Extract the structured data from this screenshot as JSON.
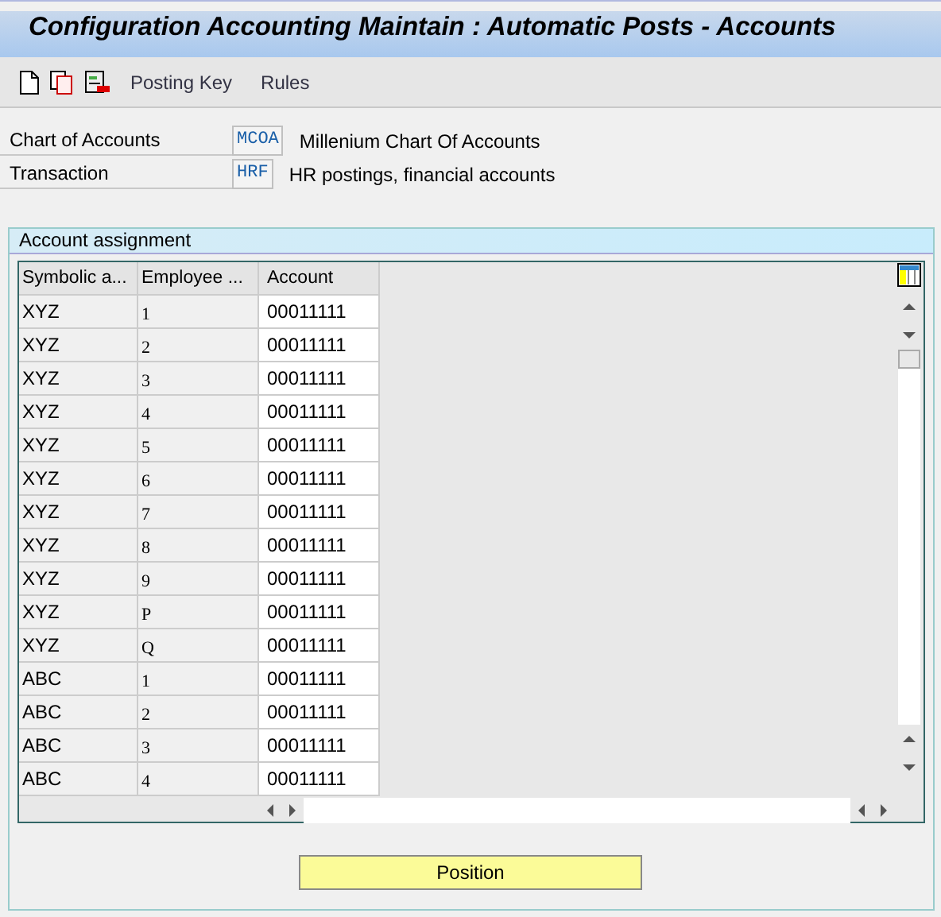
{
  "window": {
    "title": "Configuration Accounting Maintain : Automatic Posts - Accounts"
  },
  "toolbar": {
    "links": [
      "Posting Key",
      "Rules"
    ]
  },
  "fields": [
    {
      "label": "Chart of Accounts",
      "value": "MCOA",
      "description": "Millenium Chart Of Accounts"
    },
    {
      "label": "Transaction",
      "value": "HRF",
      "description": "HR postings, financial accounts"
    }
  ],
  "group": {
    "title": "Account assignment"
  },
  "table": {
    "columns": [
      "Symbolic a...",
      "Employee ...",
      "Account"
    ],
    "rows": [
      [
        "XYZ",
        "1",
        "00011111"
      ],
      [
        "XYZ",
        "2",
        "00011111"
      ],
      [
        "XYZ",
        "3",
        "00011111"
      ],
      [
        "XYZ",
        "4",
        "00011111"
      ],
      [
        "XYZ",
        "5",
        "00011111"
      ],
      [
        "XYZ",
        "6",
        "00011111"
      ],
      [
        "XYZ",
        "7",
        "00011111"
      ],
      [
        "XYZ",
        "8",
        "00011111"
      ],
      [
        "XYZ",
        "9",
        "00011111"
      ],
      [
        "XYZ",
        "P",
        "00011111"
      ],
      [
        "XYZ",
        "Q",
        "00011111"
      ],
      [
        "ABC",
        "1",
        "00011111"
      ],
      [
        "ABC",
        "2",
        "00011111"
      ],
      [
        "ABC",
        "3",
        "00011111"
      ],
      [
        "ABC",
        "4",
        "00011111"
      ]
    ]
  },
  "buttons": [
    "Position"
  ]
}
